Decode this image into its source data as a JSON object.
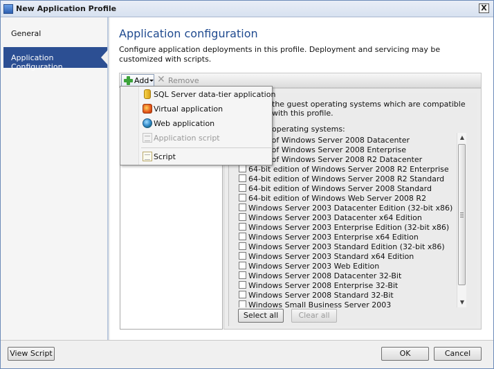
{
  "window": {
    "title": "New Application Profile",
    "close_label": "X"
  },
  "sidebar": {
    "items": [
      {
        "label": "General",
        "active": false
      },
      {
        "label": "Application Configuration",
        "active": true
      }
    ]
  },
  "main": {
    "heading": "Application configuration",
    "description": "Configure application deployments in this profile. Deployment and servicing may be customized with scripts."
  },
  "toolbar": {
    "add_label": "Add",
    "remove_label": "Remove"
  },
  "add_menu": {
    "items": [
      {
        "label": "SQL Server data-tier application",
        "icon": "sql-icon",
        "enabled": true
      },
      {
        "label": "Virtual application",
        "icon": "virtual-app-icon",
        "enabled": true
      },
      {
        "label": "Web application",
        "icon": "web-globe-icon",
        "enabled": true
      },
      {
        "label": "Application script",
        "icon": "script-icon",
        "enabled": false
      },
      {
        "label": "Script",
        "icon": "script-icon",
        "enabled": true
      }
    ]
  },
  "compatibility": {
    "text_visible": "the guest operating systems which are compatible with this profile.",
    "label_visible": "operating systems:",
    "os_list": [
      "ition of Windows Server 2008 Datacenter",
      "ition of Windows Server 2008 Enterprise",
      "ition of Windows Server 2008 R2 Datacenter",
      "64-bit edition of Windows Server 2008 R2 Enterprise",
      "64-bit edition of Windows Server 2008 R2 Standard",
      "64-bit edition of Windows Server 2008 Standard",
      "64-bit edition of Windows Web Server 2008 R2",
      "Windows Server 2003 Datacenter Edition (32-bit x86)",
      "Windows Server 2003 Datacenter x64 Edition",
      "Windows Server 2003 Enterprise Edition (32-bit x86)",
      "Windows Server 2003 Enterprise x64 Edition",
      "Windows Server 2003 Standard Edition (32-bit x86)",
      "Windows Server 2003 Standard x64 Edition",
      "Windows Server 2003 Web Edition",
      "Windows Server 2008 Datacenter 32-Bit",
      "Windows Server 2008 Enterprise 32-Bit",
      "Windows Server 2008 Standard 32-Bit",
      "Windows Small Business Server 2003"
    ],
    "select_all_label": "Select all",
    "clear_all_label": "Clear all"
  },
  "footer": {
    "view_script_label": "View Script",
    "ok_label": "OK",
    "cancel_label": "Cancel"
  }
}
